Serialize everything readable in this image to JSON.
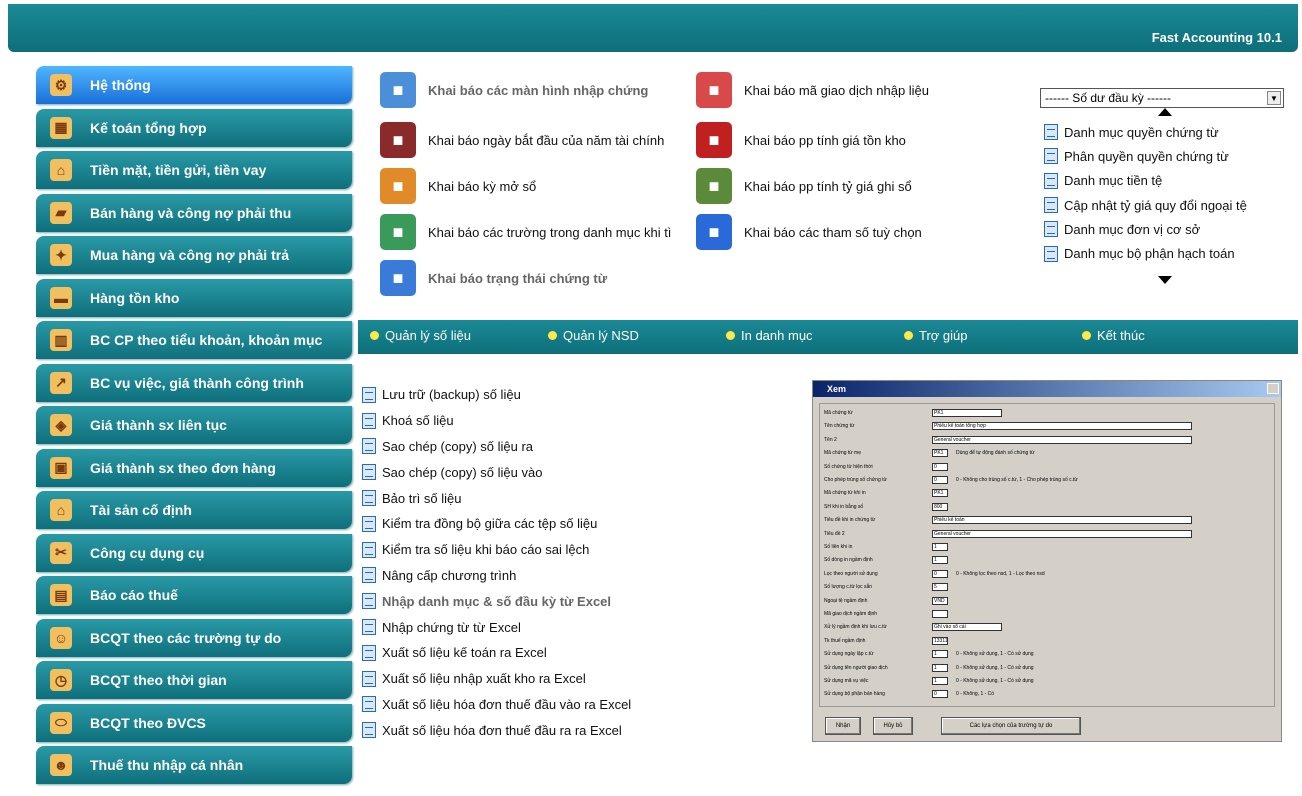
{
  "app_title": "Fast Accounting 10.1",
  "sidebar": {
    "items": [
      {
        "label": "Hệ thống",
        "icon": "gear-icon",
        "active": true
      },
      {
        "label": "Kế toán tổng hợp",
        "icon": "calculator-icon"
      },
      {
        "label": "Tiền mặt, tiền gửi, tiền vay",
        "icon": "bank-icon"
      },
      {
        "label": "Bán hàng và công nợ phải thu",
        "icon": "truck-icon"
      },
      {
        "label": "Mua hàng và công nợ phải trả",
        "icon": "purchase-icon"
      },
      {
        "label": "Hàng tồn kho",
        "icon": "warehouse-icon"
      },
      {
        "label": "BC CP theo tiểu khoản, khoản mục",
        "icon": "building-icon"
      },
      {
        "label": "BC vụ việc, giá thành công trình",
        "icon": "chart-icon"
      },
      {
        "label": "Giá thành sx liên tục",
        "icon": "factory-icon"
      },
      {
        "label": "Giá thành sx theo đơn hàng",
        "icon": "order-icon"
      },
      {
        "label": "Tài sản cố định",
        "icon": "house-icon"
      },
      {
        "label": "Công cụ dụng cụ",
        "icon": "tools-icon"
      },
      {
        "label": "Báo cáo thuế",
        "icon": "tax-icon"
      },
      {
        "label": "BCQT theo các trường tự do",
        "icon": "users-icon"
      },
      {
        "label": "BCQT theo thời gian",
        "icon": "clock-icon"
      },
      {
        "label": "BCQT theo ĐVCS",
        "icon": "pill-icon"
      },
      {
        "label": "Thuế thu nhập cá nhân",
        "icon": "person-icon"
      }
    ]
  },
  "grid": {
    "items": [
      {
        "label": "Khai báo các màn hình nhập chứng",
        "bold": true,
        "icon": "edit-document-icon",
        "color": "#4a8fd8"
      },
      {
        "label": "Khai báo mã giao dịch nhập liệu",
        "icon": "form-pen-icon",
        "color": "#d84a4a"
      },
      {
        "label": "Khai báo ngày bắt đầu của năm tài chính",
        "icon": "calendar-icon",
        "color": "#8a2a2a"
      },
      {
        "label": "Khai báo pp tính giá tồn kho",
        "icon": "cabinet-icon",
        "color": "#c02020"
      },
      {
        "label": "Khai báo kỳ mở sổ",
        "icon": "tools-icon",
        "color": "#e08a2a"
      },
      {
        "label": "Khai báo pp tính tỷ giá ghi sổ",
        "icon": "money-icon",
        "color": "#5a8a3a"
      },
      {
        "label": "Khai báo các trường trong danh mục khi tì",
        "icon": "search-badge-icon",
        "color": "#3a9a5a"
      },
      {
        "label": "Khai báo các tham số tuỳ chọn",
        "icon": "gears-icon",
        "color": "#2a6ad8"
      },
      {
        "label": "Khai báo trạng thái chứng từ",
        "bold": true,
        "icon": "windows-icon",
        "color": "#3a7ad8"
      }
    ]
  },
  "right_panel": {
    "dropdown_value": "------ Số dư đầu kỳ ------",
    "items": [
      "Danh mục quyền chứng từ",
      "Phân quyền quyền chứng từ",
      "Danh mục tiền tệ",
      "Cập nhật tỷ giá quy đổi ngoại tệ",
      "Danh mục đơn vị cơ sở",
      "Danh mục bộ phận hạch toán"
    ]
  },
  "tabs": [
    {
      "label": "Quản lý số liệu"
    },
    {
      "label": "Quản lý NSD"
    },
    {
      "label": "In danh mục"
    },
    {
      "label": "Trợ giúp"
    },
    {
      "label": "Kết thúc"
    }
  ],
  "left_list": [
    {
      "label": "Lưu trữ (backup) số liệu"
    },
    {
      "label": "Khoá số liệu"
    },
    {
      "label": "Sao chép (copy) số liệu ra"
    },
    {
      "label": "Sao chép (copy) số liệu vào"
    },
    {
      "label": "Bảo trì số liệu"
    },
    {
      "label": "Kiểm tra đồng bộ giữa các tệp số liệu"
    },
    {
      "label": "Kiểm tra số liệu khi báo cáo sai lệch"
    },
    {
      "label": "Nâng cấp chương trình"
    },
    {
      "label": "Nhập danh mục & số đầu kỳ từ Excel",
      "bold": true
    },
    {
      "label": "Nhập chứng từ từ Excel"
    },
    {
      "label": "Xuất số liệu kế toán ra Excel"
    },
    {
      "label": "Xuất số liệu nhập xuất kho ra Excel"
    },
    {
      "label": "Xuất số liệu hóa đơn thuế đầu vào ra Excel"
    },
    {
      "label": "Xuất số liệu hóa đơn thuế đầu ra ra Excel"
    }
  ],
  "dialog": {
    "title": "Xem",
    "rows": [
      {
        "label": "Mã chứng từ",
        "value": "PK1",
        "w": 70
      },
      {
        "label": "Tên chứng từ",
        "value": "Phiếu kế toán tổng hợp",
        "w": 260
      },
      {
        "label": "Tên 2",
        "value": "General voucher",
        "w": 260
      },
      {
        "label": "Mã chứng từ mẹ",
        "value": "PK1",
        "w": 16,
        "note": "Dùng để tự động đánh số chứng từ"
      },
      {
        "label": "Số chứng từ hiện thời",
        "value": "0",
        "w": 16
      },
      {
        "label": "Cho phép trùng số chứng từ",
        "value": "0",
        "w": 16,
        "note": "0 - Không cho trùng số c.từ, 1 - Cho phép trùng số c.từ"
      },
      {
        "label": "Mã chứng từ khi in",
        "value": "PK1",
        "w": 16
      },
      {
        "label": "SH khi in bằng số",
        "value": "800",
        "w": 16
      },
      {
        "label": "Tiêu đề khi in chứng từ",
        "value": "Phiếu kế toán",
        "w": 260
      },
      {
        "label": "Tiêu đề 2",
        "value": "General voucher",
        "w": 260
      },
      {
        "label": "Số liên khi in",
        "value": "1",
        "w": 16
      },
      {
        "label": "Số dòng in ngầm định",
        "value": "1",
        "w": 16
      },
      {
        "label": "Lọc theo người sử dụng",
        "value": "0",
        "w": 16,
        "note": "0 - Không lọc theo nsd, 1 - Lọc theo nsd"
      },
      {
        "label": "Số lượng c.từ lọc sẵn",
        "value": "5",
        "w": 16
      },
      {
        "label": "Ngoại tệ ngầm định",
        "value": "VND",
        "w": 16
      },
      {
        "label": "Mã giao dịch ngầm định",
        "value": "",
        "w": 16
      },
      {
        "label": "Xử lý ngầm định khi lưu c.từ",
        "value": "Ghi vào sổ cái",
        "w": 70
      },
      {
        "label": "Tk thuế ngầm định",
        "value": "13311",
        "w": 16
      },
      {
        "label": "Sử dụng ngày lập c.từ",
        "value": "1",
        "w": 16,
        "note": "0 - Không sử dụng, 1 - Có sử dụng"
      },
      {
        "label": "Sử dụng tên người giao dịch",
        "value": "1",
        "w": 16,
        "note": "0 - Không sử dụng, 1 - Có sử dụng"
      },
      {
        "label": "Sử dụng mã vụ việc",
        "value": "1",
        "w": 16,
        "note": "0 - Không sử dụng, 1 - Có sử dụng"
      },
      {
        "label": "Sử dụng bộ phận bán hàng",
        "value": "0",
        "w": 16,
        "note": "0 - Không, 1 - Có"
      }
    ],
    "buttons": [
      "Nhận",
      "Hủy bỏ",
      "Các lựa chọn của trường tự do"
    ]
  }
}
